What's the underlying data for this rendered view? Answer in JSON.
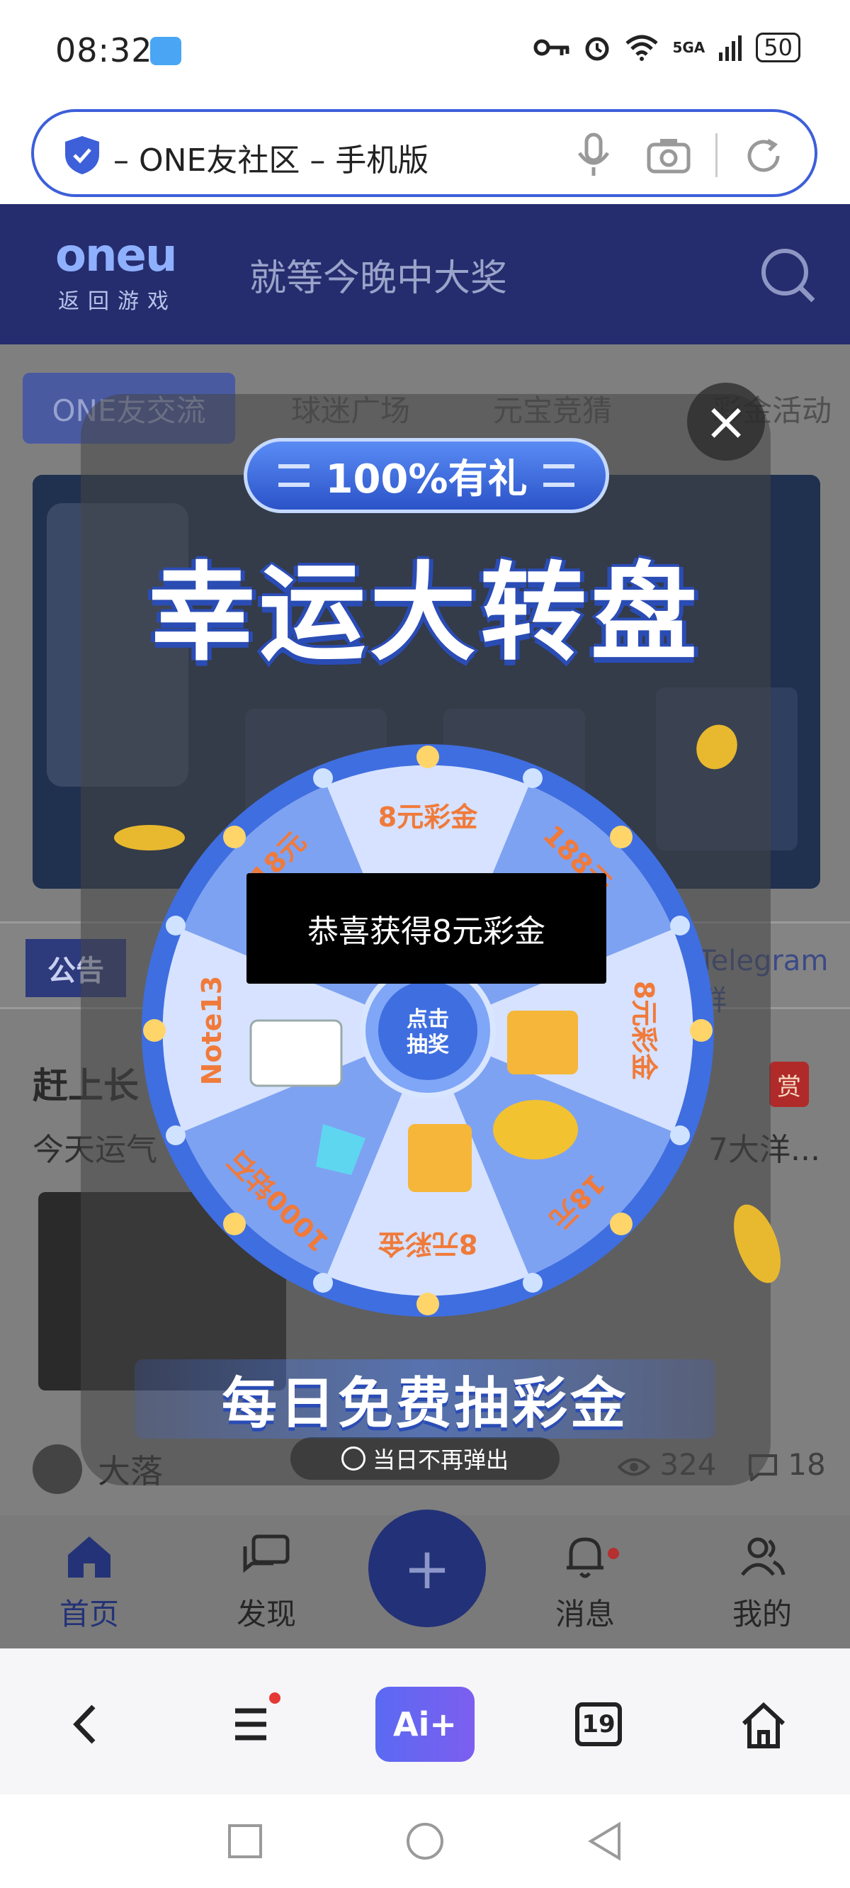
{
  "status_bar": {
    "time": "08:32",
    "battery": "50",
    "network": "5GA"
  },
  "url_bar": {
    "title": "– ONE友社区 – 手机版"
  },
  "site_header": {
    "logo": "oneu",
    "back_label": "返回游戏",
    "slogan": "就等今晚中大奖"
  },
  "tabs": [
    "ONE友交流",
    "球迷广场",
    "元宝竞猜",
    "彩金活动"
  ],
  "announcement": {
    "badge": "公告",
    "text_right": "Telegram群"
  },
  "post": {
    "title": "赶上长",
    "body_left": "今天运气",
    "body_right": "7大洋...",
    "reward": "赏",
    "author": "大落",
    "views": "324",
    "comments": "18"
  },
  "popup": {
    "pill": "100%有礼",
    "headline": "幸运大转盘",
    "wheel_center": "点击\n抽奖",
    "segments": [
      "8元彩金",
      "188元",
      "8元彩金",
      "18元",
      "8元彩金",
      "1000钻石",
      "Note13",
      "18元"
    ],
    "toast": "恭喜获得8元彩金",
    "footer": "每日免费抽彩金",
    "dont_show": "当日不再弹出"
  },
  "bottom_nav": [
    {
      "label": "首页",
      "icon": "home-icon"
    },
    {
      "label": "发现",
      "icon": "chat-icon"
    },
    {
      "label": "消息",
      "icon": "bell-icon"
    },
    {
      "label": "我的",
      "icon": "user-icon"
    }
  ],
  "browser_bar": {
    "ai": "Ai+",
    "tabs_count": "19"
  },
  "colors": {
    "brand": "#252d6e",
    "accent": "#3d5fd9",
    "wheel": "#3f6ee0"
  }
}
